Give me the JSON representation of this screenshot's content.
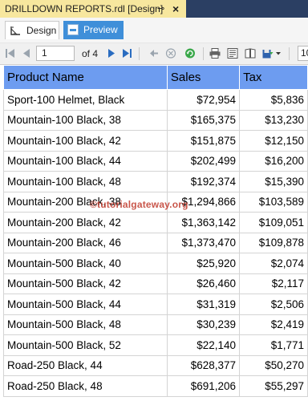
{
  "document_tab": {
    "title": "DRILLDOWN REPORTS.rdl [Design]",
    "pin_glyph": "⊸",
    "close_glyph": "×"
  },
  "mode_tabs": {
    "design": "Design",
    "preview": "Preview"
  },
  "toolbar": {
    "page_value": "1",
    "page_of": "of 4",
    "zoom_value": "10"
  },
  "table": {
    "headers": [
      "Product Name",
      "Sales",
      "Tax"
    ],
    "rows": [
      [
        "Sport-100 Helmet, Black",
        "$72,954",
        "$5,836"
      ],
      [
        "Mountain-100 Black, 38",
        "$165,375",
        "$13,230"
      ],
      [
        "Mountain-100 Black, 42",
        "$151,875",
        "$12,150"
      ],
      [
        "Mountain-100 Black, 44",
        "$202,499",
        "$16,200"
      ],
      [
        "Mountain-100 Black, 48",
        "$192,374",
        "$15,390"
      ],
      [
        "Mountain-200 Black, 38",
        "$1,294,866",
        "$103,589"
      ],
      [
        "Mountain-200 Black, 42",
        "$1,363,142",
        "$109,051"
      ],
      [
        "Mountain-200 Black, 46",
        "$1,373,470",
        "$109,878"
      ],
      [
        "Mountain-500 Black, 40",
        "$25,920",
        "$2,074"
      ],
      [
        "Mountain-500 Black, 42",
        "$26,460",
        "$2,117"
      ],
      [
        "Mountain-500 Black, 44",
        "$31,319",
        "$2,506"
      ],
      [
        "Mountain-500 Black, 48",
        "$30,239",
        "$2,419"
      ],
      [
        "Mountain-500 Black, 52",
        "$22,140",
        "$1,771"
      ],
      [
        "Road-250 Black, 44",
        "$628,377",
        "$50,270"
      ],
      [
        "Road-250 Black, 48",
        "$691,206",
        "$55,297"
      ]
    ]
  },
  "watermark": "©tutorialgateway.org",
  "colors": {
    "header_bg": "#6d9cf0",
    "doc_tab_bg": "#f7e79e",
    "preview_tab_bg": "#3f8fd9"
  }
}
